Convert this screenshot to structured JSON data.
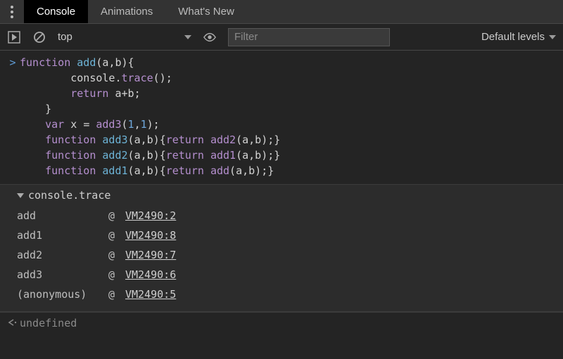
{
  "tabs": {
    "items": [
      "Console",
      "Animations",
      "What's New"
    ],
    "active": 0
  },
  "toolbar": {
    "context": "top",
    "filter_placeholder": "Filter",
    "levels_label": "Default levels"
  },
  "input": {
    "prompt": ">",
    "code_lines": [
      {
        "indent": 0,
        "tokens": [
          [
            "kw",
            "function "
          ],
          [
            "fn",
            "add"
          ],
          [
            "pn",
            "("
          ],
          [
            "pn",
            "a"
          ],
          [
            "pn",
            ","
          ],
          [
            "pn",
            "b"
          ],
          [
            "pn",
            ")"
          ],
          [
            "pn",
            "{"
          ]
        ]
      },
      {
        "indent": 8,
        "tokens": [
          [
            "obj",
            "console"
          ],
          [
            "dot",
            "."
          ],
          [
            "fncall",
            "trace"
          ],
          [
            "pn",
            "()"
          ],
          [
            "pn",
            ";"
          ]
        ]
      },
      {
        "indent": 8,
        "tokens": [
          [
            "kw",
            "return "
          ],
          [
            "pn",
            "a"
          ],
          [
            "op",
            "+"
          ],
          [
            "pn",
            "b"
          ],
          [
            "pn",
            ";"
          ]
        ]
      },
      {
        "indent": 4,
        "tokens": [
          [
            "pn",
            "}"
          ]
        ]
      },
      {
        "indent": 4,
        "tokens": [
          [
            "kw",
            "var "
          ],
          [
            "pn",
            "x "
          ],
          [
            "op",
            "= "
          ],
          [
            "fncall",
            "add3"
          ],
          [
            "pn",
            "("
          ],
          [
            "num",
            "1"
          ],
          [
            "pn",
            ","
          ],
          [
            "num",
            "1"
          ],
          [
            "pn",
            ")"
          ],
          [
            "pn",
            ";"
          ]
        ]
      },
      {
        "indent": 4,
        "tokens": [
          [
            "kw",
            "function "
          ],
          [
            "fn",
            "add3"
          ],
          [
            "pn",
            "("
          ],
          [
            "pn",
            "a"
          ],
          [
            "pn",
            ","
          ],
          [
            "pn",
            "b"
          ],
          [
            "pn",
            ")"
          ],
          [
            "pn",
            "{"
          ],
          [
            "kw",
            "return "
          ],
          [
            "fncall",
            "add2"
          ],
          [
            "pn",
            "("
          ],
          [
            "pn",
            "a"
          ],
          [
            "pn",
            ","
          ],
          [
            "pn",
            "b"
          ],
          [
            "pn",
            ")"
          ],
          [
            "pn",
            ";"
          ],
          [
            "pn",
            "}"
          ]
        ]
      },
      {
        "indent": 4,
        "tokens": [
          [
            "kw",
            "function "
          ],
          [
            "fn",
            "add2"
          ],
          [
            "pn",
            "("
          ],
          [
            "pn",
            "a"
          ],
          [
            "pn",
            ","
          ],
          [
            "pn",
            "b"
          ],
          [
            "pn",
            ")"
          ],
          [
            "pn",
            "{"
          ],
          [
            "kw",
            "return "
          ],
          [
            "fncall",
            "add1"
          ],
          [
            "pn",
            "("
          ],
          [
            "pn",
            "a"
          ],
          [
            "pn",
            ","
          ],
          [
            "pn",
            "b"
          ],
          [
            "pn",
            ")"
          ],
          [
            "pn",
            ";"
          ],
          [
            "pn",
            "}"
          ]
        ]
      },
      {
        "indent": 4,
        "tokens": [
          [
            "kw",
            "function "
          ],
          [
            "fn",
            "add1"
          ],
          [
            "pn",
            "("
          ],
          [
            "pn",
            "a"
          ],
          [
            "pn",
            ","
          ],
          [
            "pn",
            "b"
          ],
          [
            "pn",
            ")"
          ],
          [
            "pn",
            "{"
          ],
          [
            "kw",
            "return "
          ],
          [
            "fncall",
            "add"
          ],
          [
            "pn",
            "("
          ],
          [
            "pn",
            "a"
          ],
          [
            "pn",
            ","
          ],
          [
            "pn",
            "b"
          ],
          [
            "pn",
            ")"
          ],
          [
            "pn",
            ";"
          ],
          [
            "pn",
            "}"
          ]
        ]
      }
    ]
  },
  "trace": {
    "header": "console.trace",
    "rows": [
      {
        "name": "add",
        "at": "@",
        "src": "VM2490:2"
      },
      {
        "name": "add1",
        "at": "@",
        "src": "VM2490:8"
      },
      {
        "name": "add2",
        "at": "@",
        "src": "VM2490:7"
      },
      {
        "name": "add3",
        "at": "@",
        "src": "VM2490:6"
      },
      {
        "name": "(anonymous)",
        "at": "@",
        "src": "VM2490:5"
      }
    ]
  },
  "output": {
    "prompt": "<·",
    "value": "undefined"
  }
}
